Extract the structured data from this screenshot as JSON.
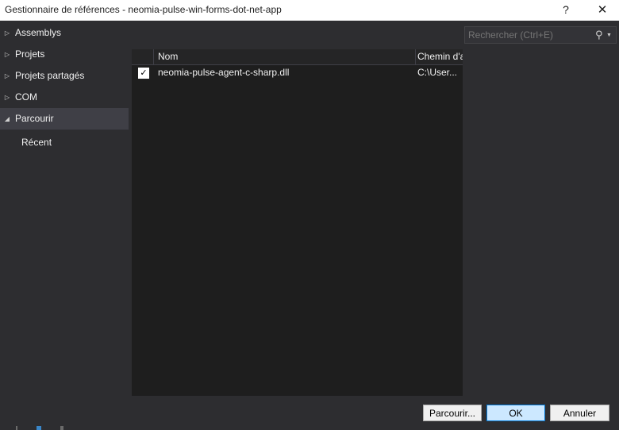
{
  "window": {
    "title": "Gestionnaire de références - neomia-pulse-win-forms-dot-net-app",
    "help_glyph": "?",
    "close_glyph": "✕"
  },
  "tree": {
    "items": [
      {
        "label": "Assemblys",
        "icon": "triangle-right-icon"
      },
      {
        "label": "Projets",
        "icon": "triangle-right-icon"
      },
      {
        "label": "Projets partagés",
        "icon": "triangle-right-icon"
      },
      {
        "label": "COM",
        "icon": "triangle-right-icon"
      },
      {
        "label": "Parcourir",
        "icon": "triangle-down-icon",
        "selected": true
      }
    ],
    "subitems": [
      {
        "label": "Récent"
      }
    ]
  },
  "search": {
    "placeholder": "Rechercher (Ctrl+E)",
    "value": "",
    "icon": "search-icon"
  },
  "list": {
    "columns": [
      "",
      "Nom",
      "Chemin d'a"
    ],
    "rows": [
      {
        "checked": true,
        "name": "neomia-pulse-agent-c-sharp.dll",
        "path": "C:\\User..."
      }
    ]
  },
  "buttons": {
    "browse": "Parcourir...",
    "ok": "OK",
    "cancel": "Annuler"
  },
  "colors": {
    "background": "#2d2d30",
    "list_background": "#1e1e1e",
    "selected": "#3f3f46",
    "ok_accent": "#0078d7"
  }
}
